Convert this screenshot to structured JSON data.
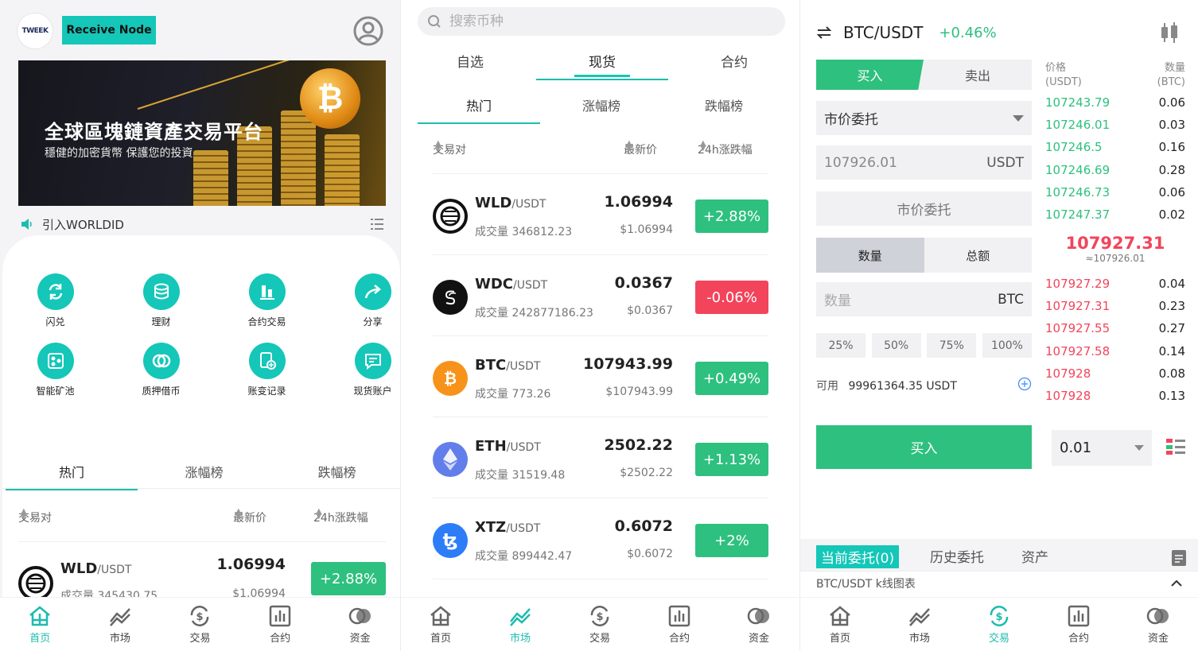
{
  "nav": [
    {
      "label": "首页"
    },
    {
      "label": "市场"
    },
    {
      "label": "交易"
    },
    {
      "label": "合约"
    },
    {
      "label": "资金"
    }
  ],
  "home": {
    "logo_text": "TWEEK",
    "receive_label": "Receive Node",
    "banner_title": "全球區塊鏈資產交易平台",
    "banner_sub": "穩健的加密貨幣 保護您的投資",
    "notice": "引入WORLDID",
    "features": [
      "闪兑",
      "理财",
      "合约交易",
      "分享",
      "智能矿池",
      "质押借币",
      "账变记录",
      "现货账户"
    ],
    "tabs": [
      "热门",
      "涨幅榜",
      "跌幅榜"
    ],
    "cols": {
      "pair": "交易对",
      "price": "最新价",
      "change": "24h涨跌幅"
    },
    "row": {
      "base": "WLD",
      "quote": "/USDT",
      "price": "1.06994",
      "vol": "成交量 345430.75",
      "uprice": "$1.06994",
      "change": "+2.88%"
    }
  },
  "market": {
    "search_placeholder": "搜索币种",
    "top_tabs": [
      "自选",
      "现货",
      "合约"
    ],
    "sub_tabs": [
      "热门",
      "涨幅榜",
      "跌幅榜"
    ],
    "cols": {
      "pair": "交易对",
      "price": "最新价",
      "change": "24h涨跌幅"
    },
    "rows": [
      {
        "base": "WLD",
        "quote": "/USDT",
        "vol": "成交量 346812.23",
        "price": "1.06994",
        "uprice": "$1.06994",
        "change": "+2.88%",
        "dir": "up"
      },
      {
        "base": "WDC",
        "quote": "/USDT",
        "vol": "成交量 242877186.23",
        "price": "0.0367",
        "uprice": "$0.0367",
        "change": "-0.06%",
        "dir": "down"
      },
      {
        "base": "BTC",
        "quote": "/USDT",
        "vol": "成交量 773.26",
        "price": "107943.99",
        "uprice": "$107943.99",
        "change": "+0.49%",
        "dir": "up"
      },
      {
        "base": "ETH",
        "quote": "/USDT",
        "vol": "成交量 31519.48",
        "price": "2502.22",
        "uprice": "$2502.22",
        "change": "+1.13%",
        "dir": "up"
      },
      {
        "base": "XTZ",
        "quote": "/USDT",
        "vol": "成交量 899442.47",
        "price": "0.6072",
        "uprice": "$0.6072",
        "change": "+2%",
        "dir": "up"
      }
    ]
  },
  "trade": {
    "pair": "BTC/USDT",
    "change": "+0.46%",
    "buy_tab": "买入",
    "sell_tab": "卖出",
    "order_type": "市价委托",
    "price_value": "107926.01",
    "price_unit": "USDT",
    "market_order_label": "市价委托",
    "amount_tab": "数量",
    "total_tab": "总额",
    "amount_placeholder": "数量",
    "amount_unit": "BTC",
    "percents": [
      "25%",
      "50%",
      "75%",
      "100%"
    ],
    "available_label": "可用",
    "available_value": "99961364.35 USDT",
    "buy_button": "买入",
    "depth_value": "0.01",
    "ob_price_head": [
      "价格",
      "(USDT)"
    ],
    "ob_qty_head": [
      "数量",
      "(BTC)"
    ],
    "asks": [
      {
        "p": "107243.79",
        "q": "0.06"
      },
      {
        "p": "107246.01",
        "q": "0.03"
      },
      {
        "p": "107246.5",
        "q": "0.16"
      },
      {
        "p": "107246.69",
        "q": "0.28"
      },
      {
        "p": "107246.73",
        "q": "0.06"
      },
      {
        "p": "107247.37",
        "q": "0.02"
      }
    ],
    "mid_price": "107927.31",
    "mid_approx": "≈107926.01",
    "bids": [
      {
        "p": "107927.29",
        "q": "0.04"
      },
      {
        "p": "107927.31",
        "q": "0.23"
      },
      {
        "p": "107927.55",
        "q": "0.27"
      },
      {
        "p": "107927.58",
        "q": "0.14"
      },
      {
        "p": "107928",
        "q": "0.08"
      },
      {
        "p": "107928",
        "q": "0.13"
      }
    ],
    "order_tabs": [
      "当前委托(0)",
      "历史委托",
      "资产"
    ],
    "kline_label": "BTC/USDT k线图表"
  },
  "colors": {
    "accent": "#14c7b8",
    "up": "#2ec07e",
    "down": "#f2445b"
  }
}
